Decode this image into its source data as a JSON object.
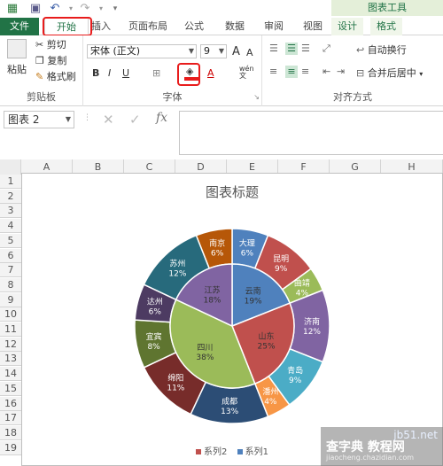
{
  "colors": {
    "accent": "#217346",
    "highlight": "#e81c1c"
  },
  "titlebar": {
    "chart_tools": "图表工具"
  },
  "tabs": [
    "文件",
    "开始",
    "插入",
    "页面布局",
    "公式",
    "数据",
    "审阅",
    "视图",
    "设计",
    "格式"
  ],
  "ribbon": {
    "clipboard": {
      "paste": "粘贴",
      "cut": "剪切",
      "copy": "复制",
      "format_painter": "格式刷",
      "group": "剪贴板"
    },
    "font": {
      "name": "宋体 (正文)",
      "size": "9",
      "grow": "A",
      "shrink": "A",
      "bold": "B",
      "italic": "I",
      "underline": "U",
      "color_a": "A",
      "wen": "wén\n文",
      "group": "字体"
    },
    "align": {
      "wrap": "自动换行",
      "merge": "合并后居中",
      "group": "对齐方式"
    }
  },
  "formula_bar": {
    "name_box": "图表 2",
    "fx": "fx"
  },
  "sheet": {
    "columns": [
      "A",
      "B",
      "C",
      "D",
      "E",
      "F",
      "G",
      "H"
    ],
    "rows": [
      "1",
      "2",
      "3",
      "4",
      "5",
      "6",
      "7",
      "8",
      "9",
      "10",
      "11",
      "12",
      "13",
      "14",
      "15",
      "16",
      "17",
      "18",
      "19"
    ]
  },
  "chart_data": {
    "type": "pie",
    "title": "图表标题",
    "legend": [
      "系列2",
      "系列1"
    ],
    "legend_position": "bottom",
    "series": [
      {
        "name": "系列1",
        "labels": [
          "云南",
          "山东",
          "四川",
          "江苏"
        ],
        "values": [
          19,
          25,
          38,
          18
        ],
        "colors": [
          "#4f81bd",
          "#c0504d",
          "#9bbb59",
          "#8064a2"
        ]
      },
      {
        "name": "系列2",
        "labels": [
          "大理",
          "昆明",
          "曲靖",
          "济南",
          "青岛",
          "潘州",
          "成都",
          "绵阳",
          "宜宾",
          "达州",
          "苏州",
          "南京"
        ],
        "values": [
          6,
          9,
          4,
          12,
          9,
          4,
          13,
          11,
          8,
          6,
          12,
          6
        ],
        "colors": [
          "#4f81bd",
          "#c0504d",
          "#9bbb59",
          "#8064a2",
          "#4bacc6",
          "#f79646",
          "#2c4d75",
          "#772c2a",
          "#5f7530",
          "#4d3b62",
          "#276a7c",
          "#b65708"
        ]
      }
    ]
  },
  "watermark": {
    "line1": "查字典",
    "line2": "教程网",
    "line3": "jiaocheng.chazidian.com",
    "site": "jb51.net"
  }
}
